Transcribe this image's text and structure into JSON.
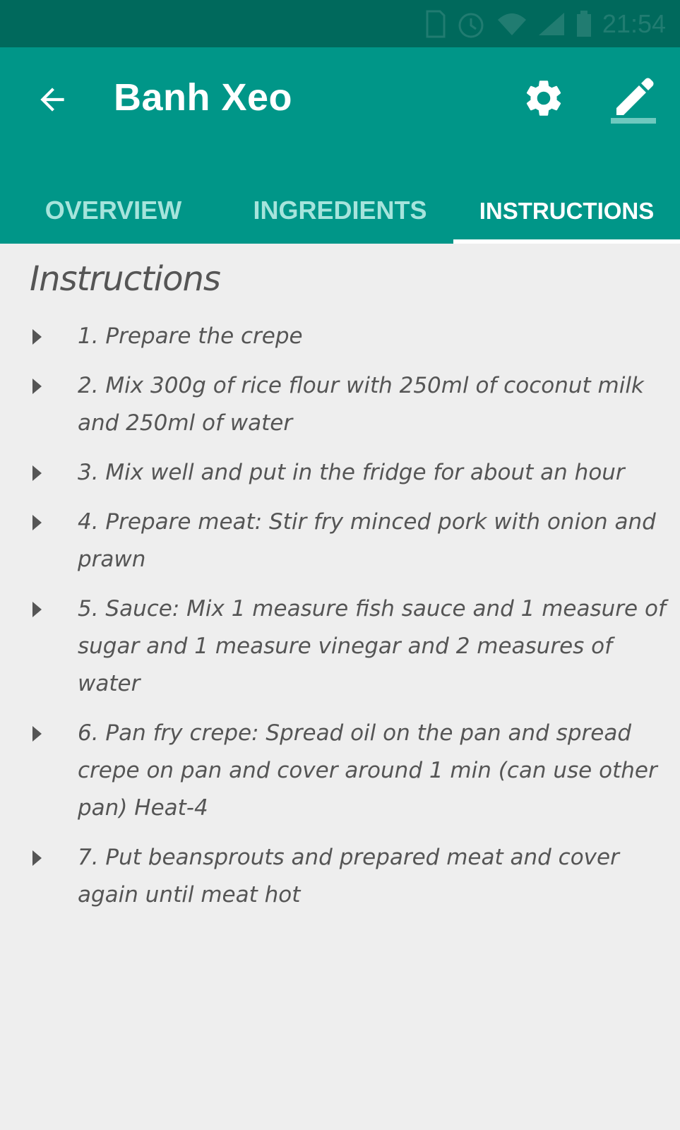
{
  "status_bar": {
    "time": "21:54"
  },
  "app_bar": {
    "title": "Banh Xeo",
    "back_icon": "arrow-back-icon",
    "settings_icon": "gear-icon",
    "edit_icon": "pencil-icon"
  },
  "tabs": [
    {
      "label": "OVERVIEW",
      "active": false
    },
    {
      "label": "INGREDIENTS",
      "active": false
    },
    {
      "label": "INSTRUCTIONS",
      "active": true
    }
  ],
  "content": {
    "section_title": "Instructions",
    "steps": [
      "1. Prepare the crepe",
      "2. Mix 300g of rice flour with 250ml of coconut milk and 250ml of water",
      "3. Mix well and put in the fridge for about an hour",
      "4. Prepare meat: Stir fry minced pork with onion and prawn",
      "5. Sauce: Mix 1 measure fish sauce and 1 measure of sugar and 1 measure vinegar and 2 measures of water",
      "6. Pan fry crepe: Spread oil on the pan and spread crepe on pan and cover around 1 min (can use other pan) Heat-4",
      "7. Put beansprouts and prepared meat and cover again until meat hot"
    ]
  },
  "colors": {
    "primary": "#009688",
    "primary_dark": "#00695c",
    "background": "#eeeeee",
    "text": "#555555",
    "tab_inactive": "#a6e4dc"
  }
}
